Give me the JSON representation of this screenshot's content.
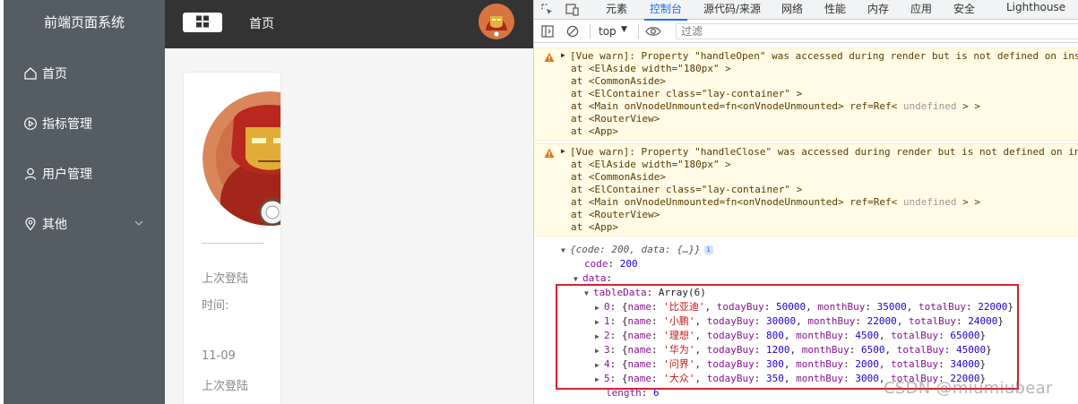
{
  "app": {
    "brand": "前端页面系统",
    "menu": [
      {
        "label": "首页",
        "icon": "house-icon"
      },
      {
        "label": "指标管理",
        "icon": "video-play-icon"
      },
      {
        "label": "用户管理",
        "icon": "user-icon"
      },
      {
        "label": "其他",
        "icon": "location-icon",
        "has_submenu": true
      }
    ],
    "breadcrumb": "首页",
    "card": {
      "text1": "上次登陆",
      "text2": "时间:",
      "text3": "11-09",
      "text4": "上次登陆"
    }
  },
  "devtools": {
    "tabs": [
      "元素",
      "控制台",
      "源代码/来源",
      "网络",
      "性能",
      "内存",
      "应用",
      "安全",
      "Lighthouse"
    ],
    "active_tab": "控制台",
    "context": "top",
    "filter_placeholder": "过滤",
    "warnings": [
      {
        "first": "[Vue warn]: Property \"handleOpen\" was accessed during render but is not defined on ins",
        "lines": [
          "at <ElAside width=\"180px\" >",
          "at <CommonAside>",
          "at <ElContainer class=\"lay-container\" >"
        ],
        "main_pre": "at <Main onVnodeUnmounted=fn<onVnodeUnmounted> ref=Ref< ",
        "main_dim": "undefined",
        "main_post": " > >",
        "tail": [
          "at <RouterView>",
          "at <App>"
        ]
      },
      {
        "first": "[Vue warn]: Property \"handleClose\" was accessed during render but is not defined on in",
        "lines": [
          "at <ElAside width=\"180px\" >",
          "at <CommonAside>",
          "at <ElContainer class=\"lay-container\" >"
        ],
        "main_pre": "at <Main onVnodeUnmounted=fn<onVnodeUnmounted> ref=Ref< ",
        "main_dim": "undefined",
        "main_post": " > >",
        "tail": [
          "at <RouterView>",
          "at <App>"
        ]
      }
    ],
    "object": {
      "summary": "{code: 200, data: {…}}",
      "code_key": "code",
      "code_value": "200",
      "data_key": "data",
      "table_key": "tableData",
      "table_type": "Array(6)",
      "items": [
        {
          "index": "0",
          "name": "比亚迪",
          "todayBuy": "50000",
          "monthBuy": "35000",
          "totalBuy": "22000"
        },
        {
          "index": "1",
          "name": "小鹏",
          "todayBuy": "30000",
          "monthBuy": "22000",
          "totalBuy": "24000"
        },
        {
          "index": "2",
          "name": "理想",
          "todayBuy": "800",
          "monthBuy": "4500",
          "totalBuy": "65000"
        },
        {
          "index": "3",
          "name": "华为",
          "todayBuy": "1200",
          "monthBuy": "6500",
          "totalBuy": "45000"
        },
        {
          "index": "4",
          "name": "问界",
          "todayBuy": "300",
          "monthBuy": "2000",
          "totalBuy": "34000"
        },
        {
          "index": "5",
          "name": "大众",
          "todayBuy": "350",
          "monthBuy": "3000",
          "totalBuy": "22000"
        }
      ],
      "length_key": "length",
      "length_value": "6"
    },
    "watermark": "CSDN @miumiubear"
  }
}
